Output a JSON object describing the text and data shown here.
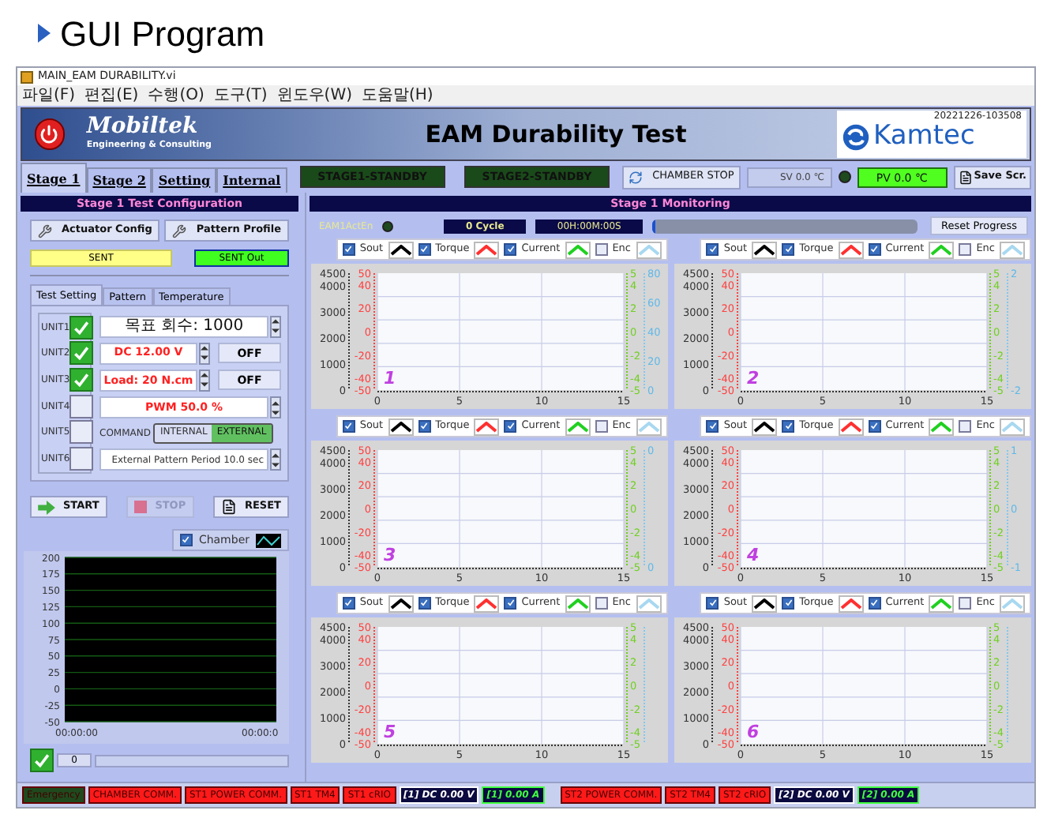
{
  "slide": {
    "title": "GUI Program"
  },
  "window": {
    "title": "MAIN_EAM DURABILITY.vi"
  },
  "menu": [
    "파일(F)",
    "편집(E)",
    "수행(O)",
    "도구(T)",
    "윈도우(W)",
    "도움말(H)"
  ],
  "header": {
    "company": "Mobiltek",
    "tagline": "Engineering & Consulting",
    "title": "EAM Durability Test",
    "brand": "Kamtec",
    "timestamp": "20221226-103508"
  },
  "tabs": [
    {
      "label": "Stage 1",
      "selected": true
    },
    {
      "label": "Stage 2",
      "selected": false
    },
    {
      "label": "Setting",
      "selected": false
    },
    {
      "label": "Internal",
      "selected": false
    }
  ],
  "stage_indicators": [
    {
      "label": "STAGE1-STANDBY",
      "on": false
    },
    {
      "label": "STAGE2-STANDBY",
      "on": false
    }
  ],
  "chamber_button": "CHAMBER STOP",
  "sv": {
    "label": "SV 0.0 ℃",
    "led_on": false
  },
  "pv": "PV 0.0 ℃",
  "save_button": "Save Scr.",
  "config": {
    "title": "Stage 1 Test Configuration",
    "buttons": [
      "Actuator Config",
      "Pattern Profile"
    ],
    "sent": "SENT",
    "sent_out": "SENT Out",
    "tabs": [
      {
        "label": "Test Setting",
        "selected": true
      },
      {
        "label": "Pattern",
        "selected": false
      },
      {
        "label": "Temperature",
        "selected": false
      }
    ],
    "units": [
      {
        "label": "UNIT1",
        "checked": true
      },
      {
        "label": "UNIT2",
        "checked": true
      },
      {
        "label": "UNIT3",
        "checked": true
      },
      {
        "label": "UNIT4",
        "checked": false
      },
      {
        "label": "UNIT5",
        "checked": false
      },
      {
        "label": "UNIT6",
        "checked": false
      }
    ],
    "target": "목표 회수: 1000",
    "voltage": {
      "value": "DC 12.00 V",
      "switch": "OFF"
    },
    "load": {
      "value": "Load: 20 N.cm",
      "switch": "OFF"
    },
    "pwm": "PWM 50.0 %",
    "command": {
      "label": "COMMAND",
      "options": [
        {
          "label": "INTERNAL",
          "selected": false
        },
        {
          "label": "EXTERNAL",
          "selected": true
        }
      ]
    },
    "period": "External Pattern Period 10.0 sec",
    "actions": [
      {
        "label": "START",
        "kind": "start",
        "disabled": false
      },
      {
        "label": "STOP",
        "kind": "stop",
        "disabled": true
      },
      {
        "label": "RESET",
        "kind": "reset",
        "disabled": false
      }
    ],
    "chamber_chart": {
      "legend": {
        "label": "Chamber",
        "checked": true
      },
      "y_ticks": [
        "200",
        "175",
        "150",
        "125",
        "100",
        "75",
        "50",
        "25",
        "0",
        "-25",
        "-50"
      ],
      "x_ticks": [
        "00:00:00",
        "00:00:0"
      ]
    },
    "scroll": {
      "checked": true,
      "value": "0"
    }
  },
  "monitoring": {
    "title": "Stage 1 Monitoring",
    "led_label": "EAM1ActEn",
    "led_on": false,
    "cycle": "0 Cycle",
    "elapsed": "00H:00M:00S",
    "progress": {
      "level": 0.01
    },
    "reset_button": "Reset Progress",
    "charts": [
      {
        "number": "1",
        "legend": [
          {
            "label": "Sout",
            "checked": true,
            "color": "#000000"
          },
          {
            "label": "Torque",
            "checked": true,
            "color": "#ff3030"
          },
          {
            "label": "Current",
            "checked": true,
            "color": "#20d020"
          },
          {
            "label": "Enc",
            "checked": false,
            "color": "#a8d8f0"
          }
        ],
        "x_ticks": [
          "0",
          "5",
          "10",
          "15"
        ],
        "sout_ticks": [
          "4500",
          "4000",
          "3000",
          "2000",
          "1000",
          "0"
        ],
        "torque_ticks": [
          "50",
          "40",
          "20",
          "0",
          "-20",
          "-40",
          "-50"
        ],
        "current_ticks": [
          "5",
          "4",
          "2",
          "0",
          "-2",
          "-4",
          "-5"
        ],
        "enc_ticks": [
          "80",
          "60",
          "40",
          "20",
          "0"
        ]
      },
      {
        "number": "2",
        "legend": [
          {
            "label": "Sout",
            "checked": true,
            "color": "#000000"
          },
          {
            "label": "Torque",
            "checked": true,
            "color": "#ff3030"
          },
          {
            "label": "Current",
            "checked": true,
            "color": "#20d020"
          },
          {
            "label": "Enc",
            "checked": false,
            "color": "#a8d8f0"
          }
        ],
        "x_ticks": [
          "0",
          "5",
          "10",
          "15"
        ],
        "sout_ticks": [
          "4500",
          "4000",
          "3000",
          "2000",
          "1000",
          "0"
        ],
        "torque_ticks": [
          "50",
          "40",
          "20",
          "0",
          "-20",
          "-40",
          "-50"
        ],
        "current_ticks": [
          "5",
          "4",
          "2",
          "0",
          "-2",
          "-4",
          "-5"
        ],
        "enc_ticks": [
          "2",
          "-2"
        ]
      },
      {
        "number": "3",
        "legend": [
          {
            "label": "Sout",
            "checked": true,
            "color": "#000000"
          },
          {
            "label": "Torque",
            "checked": true,
            "color": "#ff3030"
          },
          {
            "label": "Current",
            "checked": true,
            "color": "#20d020"
          },
          {
            "label": "Enc",
            "checked": false,
            "color": "#a8d8f0"
          }
        ],
        "x_ticks": [
          "0",
          "5",
          "10",
          "15"
        ],
        "sout_ticks": [
          "4500",
          "4000",
          "3000",
          "2000",
          "1000",
          "0"
        ],
        "torque_ticks": [
          "50",
          "40",
          "20",
          "0",
          "-20",
          "-40",
          "-50"
        ],
        "current_ticks": [
          "5",
          "4",
          "2",
          "0",
          "-2",
          "-4",
          "-5"
        ],
        "enc_ticks": [
          "0",
          "0"
        ]
      },
      {
        "number": "4",
        "legend": [
          {
            "label": "Sout",
            "checked": true,
            "color": "#000000"
          },
          {
            "label": "Torque",
            "checked": true,
            "color": "#ff3030"
          },
          {
            "label": "Current",
            "checked": true,
            "color": "#20d020"
          },
          {
            "label": "Enc",
            "checked": false,
            "color": "#a8d8f0"
          }
        ],
        "x_ticks": [
          "0",
          "5",
          "10",
          "15"
        ],
        "sout_ticks": [
          "4500",
          "4000",
          "3000",
          "2000",
          "1000",
          "0"
        ],
        "torque_ticks": [
          "50",
          "40",
          "20",
          "0",
          "-20",
          "-40",
          "-50"
        ],
        "current_ticks": [
          "5",
          "4",
          "2",
          "0",
          "-2",
          "-4",
          "-5"
        ],
        "enc_ticks": [
          "1",
          "0",
          "-1"
        ]
      },
      {
        "number": "5",
        "legend": [
          {
            "label": "Sout",
            "checked": true,
            "color": "#000000"
          },
          {
            "label": "Torque",
            "checked": true,
            "color": "#ff3030"
          },
          {
            "label": "Current",
            "checked": true,
            "color": "#20d020"
          },
          {
            "label": "Enc",
            "checked": false,
            "color": "#a8d8f0"
          }
        ],
        "x_ticks": [
          "0",
          "5",
          "10",
          "15"
        ],
        "sout_ticks": [
          "4500",
          "4000",
          "3000",
          "2000",
          "1000",
          "0"
        ],
        "torque_ticks": [
          "50",
          "40",
          "20",
          "0",
          "-20",
          "-40",
          "-50"
        ],
        "current_ticks": [
          "5",
          "4",
          "2",
          "0",
          "-2",
          "-4",
          "-5"
        ]
      },
      {
        "number": "6",
        "legend": [
          {
            "label": "Sout",
            "checked": true,
            "color": "#000000"
          },
          {
            "label": "Torque",
            "checked": true,
            "color": "#ff3030"
          },
          {
            "label": "Current",
            "checked": true,
            "color": "#20d020"
          },
          {
            "label": "Enc",
            "checked": false,
            "color": "#a8d8f0"
          }
        ],
        "x_ticks": [
          "0",
          "5",
          "10",
          "15"
        ],
        "sout_ticks": [
          "4500",
          "4000",
          "3000",
          "2000",
          "1000",
          "0"
        ],
        "torque_ticks": [
          "50",
          "40",
          "20",
          "0",
          "-20",
          "-40",
          "-50"
        ],
        "current_ticks": [
          "5",
          "4",
          "2",
          "0",
          "-2",
          "-4",
          "-5"
        ]
      }
    ]
  },
  "status_bar": [
    {
      "label": "Emergency",
      "kind": "alarm",
      "color": "#1e4a1e"
    },
    {
      "label": "CHAMBER COMM.",
      "kind": "alarm",
      "color": "#ff1a1a"
    },
    {
      "label": "ST1 POWER COMM.",
      "kind": "alarm",
      "color": "#ff1a1a"
    },
    {
      "label": "ST1 TM4",
      "kind": "alarm",
      "color": "#ff1a1a"
    },
    {
      "label": "ST1 cRIO",
      "kind": "alarm",
      "color": "#ff1a1a"
    },
    {
      "label": "[1] DC 0.00 V",
      "kind": "readout",
      "color": "#ffffff"
    },
    {
      "label": "[1] 0.00 A",
      "kind": "readout",
      "color": "#40ff40"
    },
    {
      "label": "ST2 POWER COMM.",
      "kind": "alarm",
      "color": "#ff1a1a"
    },
    {
      "label": "ST2 TM4",
      "kind": "alarm",
      "color": "#ff1a1a"
    },
    {
      "label": "ST2 cRIO",
      "kind": "alarm",
      "color": "#ff1a1a"
    },
    {
      "label": "[2] DC 0.00 V",
      "kind": "readout",
      "color": "#ffffff"
    },
    {
      "label": "[2] 0.00 A",
      "kind": "readout",
      "color": "#40ff40"
    }
  ]
}
